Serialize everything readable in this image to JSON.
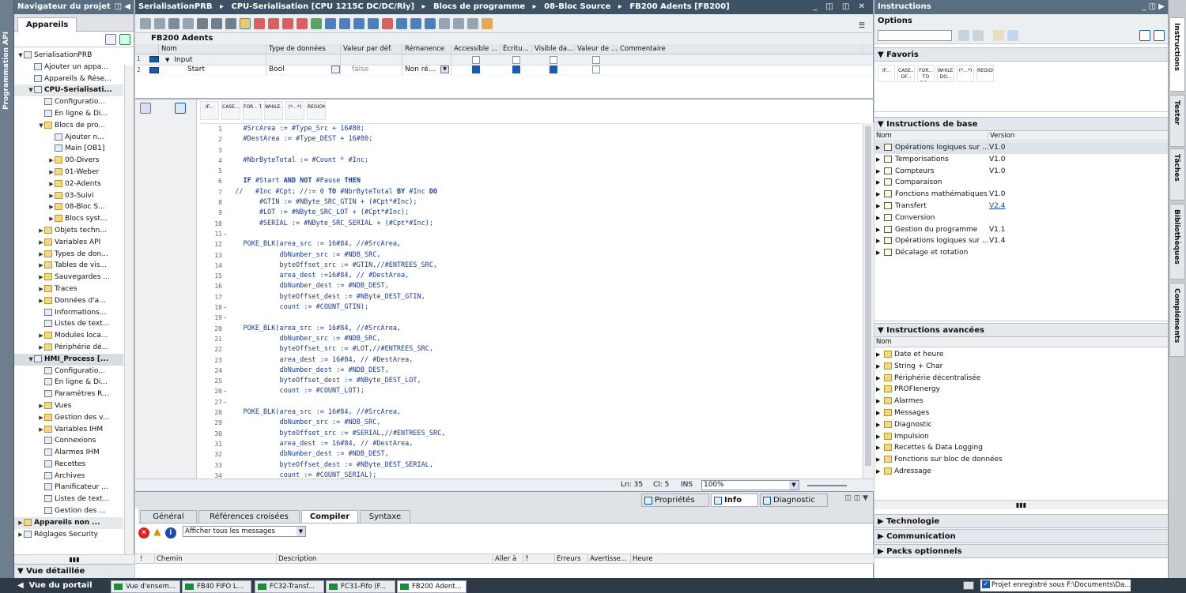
{
  "left_vtab": "Programmation API",
  "project_nav": {
    "title": "Navigateur du projet",
    "tab": "Appareils",
    "items": [
      {
        "label": "SerialisationPRB",
        "lvl": 0,
        "exp": "▼",
        "bold": false,
        "ic": "doc"
      },
      {
        "label": "Ajouter un appa...",
        "lvl": 1,
        "exp": "",
        "bold": false,
        "ic": "add"
      },
      {
        "label": "Appareils & Rése...",
        "lvl": 1,
        "exp": "",
        "bold": false,
        "ic": "net"
      },
      {
        "label": "CPU-Serialisati...",
        "lvl": 1,
        "exp": "▼",
        "bold": true,
        "ic": "cpu"
      },
      {
        "label": "Configuratio...",
        "lvl": 2,
        "exp": "",
        "bold": false,
        "ic": "cfg"
      },
      {
        "label": "En ligne & Di...",
        "lvl": 2,
        "exp": "",
        "bold": false,
        "ic": "onl"
      },
      {
        "label": "Blocs de pro...",
        "lvl": 2,
        "exp": "▼",
        "bold": false,
        "ic": "fld"
      },
      {
        "label": "Ajouter n...",
        "lvl": 3,
        "exp": "",
        "bold": false,
        "ic": "add"
      },
      {
        "label": "Main [OB1]",
        "lvl": 3,
        "exp": "",
        "bold": false,
        "ic": "blk"
      },
      {
        "label": "00-Divers",
        "lvl": 3,
        "exp": "▶",
        "bold": false,
        "ic": "fld"
      },
      {
        "label": "01-Weber",
        "lvl": 3,
        "exp": "▶",
        "bold": false,
        "ic": "fld"
      },
      {
        "label": "02-Adents",
        "lvl": 3,
        "exp": "▶",
        "bold": false,
        "ic": "fld"
      },
      {
        "label": "03-Suivi",
        "lvl": 3,
        "exp": "▶",
        "bold": false,
        "ic": "fld"
      },
      {
        "label": "08-Bloc S...",
        "lvl": 3,
        "exp": "▶",
        "bold": false,
        "ic": "fld"
      },
      {
        "label": "Blocs syst...",
        "lvl": 3,
        "exp": "▶",
        "bold": false,
        "ic": "fld"
      },
      {
        "label": "Objets techn...",
        "lvl": 2,
        "exp": "▶",
        "bold": false,
        "ic": "fld"
      },
      {
        "label": "Variables API",
        "lvl": 2,
        "exp": "▶",
        "bold": false,
        "ic": "fld"
      },
      {
        "label": "Types de don...",
        "lvl": 2,
        "exp": "▶",
        "bold": false,
        "ic": "fld"
      },
      {
        "label": "Tables de vis...",
        "lvl": 2,
        "exp": "▶",
        "bold": false,
        "ic": "fld"
      },
      {
        "label": "Sauvegardes ...",
        "lvl": 2,
        "exp": "▶",
        "bold": false,
        "ic": "fld"
      },
      {
        "label": "Traces",
        "lvl": 2,
        "exp": "▶",
        "bold": false,
        "ic": "fld"
      },
      {
        "label": "Données d'a...",
        "lvl": 2,
        "exp": "▶",
        "bold": false,
        "ic": "fld"
      },
      {
        "label": "Informations...",
        "lvl": 2,
        "exp": "",
        "bold": false,
        "ic": "doc"
      },
      {
        "label": "Listes de text...",
        "lvl": 2,
        "exp": "",
        "bold": false,
        "ic": "doc"
      },
      {
        "label": "Modules loca...",
        "lvl": 2,
        "exp": "▶",
        "bold": false,
        "ic": "fld"
      },
      {
        "label": "Périphérie dé...",
        "lvl": 2,
        "exp": "▶",
        "bold": false,
        "ic": "fld"
      },
      {
        "label": "HMI_Process [...",
        "lvl": 1,
        "exp": "▼",
        "bold": true,
        "ic": "hmi"
      },
      {
        "label": "Configuratio...",
        "lvl": 2,
        "exp": "",
        "bold": false,
        "ic": "cfg"
      },
      {
        "label": "En ligne & Di...",
        "lvl": 2,
        "exp": "",
        "bold": false,
        "ic": "onl"
      },
      {
        "label": "Paramètres R...",
        "lvl": 2,
        "exp": "",
        "bold": false,
        "ic": "cfg"
      },
      {
        "label": "Vues",
        "lvl": 2,
        "exp": "▶",
        "bold": false,
        "ic": "fld"
      },
      {
        "label": "Gestion des v...",
        "lvl": 2,
        "exp": "▶",
        "bold": false,
        "ic": "fld"
      },
      {
        "label": "Variables IHM",
        "lvl": 2,
        "exp": "▶",
        "bold": false,
        "ic": "fld"
      },
      {
        "label": "Connexions",
        "lvl": 2,
        "exp": "",
        "bold": false,
        "ic": "net"
      },
      {
        "label": "Alarmes IHM",
        "lvl": 2,
        "exp": "",
        "bold": false,
        "ic": "doc"
      },
      {
        "label": "Recettes",
        "lvl": 2,
        "exp": "",
        "bold": false,
        "ic": "doc"
      },
      {
        "label": "Archives",
        "lvl": 2,
        "exp": "",
        "bold": false,
        "ic": "doc"
      },
      {
        "label": "Planificateur ...",
        "lvl": 2,
        "exp": "",
        "bold": false,
        "ic": "doc"
      },
      {
        "label": "Listes de text...",
        "lvl": 2,
        "exp": "",
        "bold": false,
        "ic": "doc"
      },
      {
        "label": "Gestion des ...",
        "lvl": 2,
        "exp": "",
        "bold": false,
        "ic": "doc"
      },
      {
        "label": "Appareils non ...",
        "lvl": 0,
        "exp": "▶",
        "bold": true,
        "ic": "fld"
      },
      {
        "label": "Réglages Security",
        "lvl": 0,
        "exp": "▶",
        "bold": false,
        "ic": "doc"
      }
    ],
    "detail": "Vue détaillée"
  },
  "editor": {
    "breadcrumb": [
      "SerialisationPRB",
      "CPU-Serialisation [CPU 1215C DC/DC/Rly]",
      "Blocs de programme",
      "08-Bloc Source",
      "FB200 Adents [FB200]"
    ],
    "block_title": "FB200 Adents",
    "columns": [
      "Nom",
      "Type de données",
      "Valeur par déf.",
      "Rémanence",
      "Accessible ...",
      "Écritu...",
      "Visible da...",
      "Valeur de ...",
      "Commentaire"
    ],
    "rows": [
      {
        "num": "1",
        "name": "Input",
        "type": "",
        "def": "",
        "rem": ""
      },
      {
        "num": "2",
        "name": "Start",
        "type": "Bool",
        "def": "false",
        "rem": "Non ré..."
      }
    ],
    "snippets": [
      "IF...",
      "CASE... OF...",
      "FOR... TO DO...",
      "WHILE... DO...",
      "(*...*)",
      "REGION"
    ],
    "code_lines": [
      "    #SrcArea := #Type_Src + 16#80;",
      "    #DestArea := #Type_DEST + 16#80;",
      "",
      "    #NbrByteTotal := #Count * #Inc;",
      "",
      "    IF #Start AND NOT #Pause THEN",
      "  //   #Inc #Cpt; //:= 0 TO #NbrByteTotal BY #Inc DO",
      "        #GTIN := #NByte_SRC_GTIN + (#Cpt*#Inc);",
      "        #LOT := #NByte_SRC_LOT + (#Cpt*#Inc);",
      "        #SERIAL := #NByte_SRC_SERIAL + (#Cpt*#Inc);",
      "",
      "    POKE_BLK(area_src := 16#84, //#SrcArea,",
      "             dbNumber_src := #NDB_SRC,",
      "             byteOffset_src := #GTIN,//#ENTREES_SRC,",
      "             area_dest :=16#84, // #DestArea,",
      "             dbNumber_dest := #NDB_DEST,",
      "             byteOffset_dest := #NByte_DEST_GTIN,",
      "             count := #COUNT_GTIN);",
      "",
      "    POKE_BLK(area_src := 16#84, //#SrcArea,",
      "             dbNumber_src := #NDB_SRC,",
      "             byteOffset_src := #LOT,//#ENTREES_SRC,",
      "             area_dest := 16#84, // #DestArea,",
      "             dbNumber_dest := #NDB_DEST,",
      "             byteOffset_dest := #NByte_DEST_LOT,",
      "             count := #COUNT_LOT);",
      "",
      "    POKE_BLK(area_src := 16#84, //#SrcArea,",
      "             dbNumber_src := #NDB_SRC,",
      "             byteOffset_src := #SERIAL,//#ENTREES_SRC,",
      "             area_dest := 16#84, // #DestArea,",
      "             dbNumber_dest := #NDB_DEST,",
      "             byteOffset_dest := #NByte_DEST_SERIAL,",
      "             count := #COUNT_SERIAL);"
    ],
    "status": {
      "ln": "Ln: 35",
      "cl": "Cl: 5",
      "ins": "INS",
      "zoom": "100%"
    }
  },
  "inspector": {
    "tabs": [
      "Propriétés",
      "Info",
      "Diagnostic"
    ],
    "subtabs": [
      "Général",
      "Références croisées",
      "Compiler",
      "Syntaxe"
    ],
    "filter": "Afficher tous les messages",
    "columns": [
      "!",
      "Chemin",
      "Description",
      "Aller à",
      "?",
      "Erreurs",
      "Avertisse...",
      "Heure"
    ]
  },
  "instructions": {
    "title": "Instructions",
    "options": "Options",
    "favoris": "Favoris",
    "basic_title": "Instructions de base",
    "col_name": "Nom",
    "col_version": "Version",
    "basic": [
      {
        "name": "Opérations logiques sur ...",
        "version": "V1.0"
      },
      {
        "name": "Temporisations",
        "version": "V1.0"
      },
      {
        "name": "Compteurs",
        "version": "V1.0"
      },
      {
        "name": "Comparaison",
        "version": ""
      },
      {
        "name": "Fonctions mathématiques",
        "version": "V1.0"
      },
      {
        "name": "Transfert",
        "version": "V2.4"
      },
      {
        "name": "Conversion",
        "version": ""
      },
      {
        "name": "Gestion du programme",
        "version": "V1.1"
      },
      {
        "name": "Opérations logiques sur ...",
        "version": "V1.4"
      },
      {
        "name": "Décalage et rotation",
        "version": ""
      }
    ],
    "adv_title": "Instructions avancées",
    "advanced": [
      "Date et heure",
      "String + Char",
      "Périphérie décentralisée",
      "PROFIenergy",
      "Alarmes",
      "Messages",
      "Diagnostic",
      "Impulsion",
      "Recettes & Data Logging",
      "Fonctions sur bloc de données",
      "Adressage"
    ],
    "bottom": [
      "Technologie",
      "Communication",
      "Packs optionnels"
    ]
  },
  "right_vtabs": [
    "Instructions",
    "Tester",
    "Tâches",
    "Bibliothèques",
    "Compléments"
  ],
  "taskbar": {
    "portal": "Vue du portail",
    "buttons": [
      "Vue d'ensem...",
      "FB40 FIFO L...",
      "FC32-Transf...",
      "FC31-Fifo (F...",
      "FB200 Adent..."
    ],
    "status": "Projet enregistré sous F:\\Documents\\Da..."
  },
  "colors": {
    "header": "#5a6e82",
    "accent": "#1a5aa8",
    "taskbar": "#2e3a46"
  }
}
